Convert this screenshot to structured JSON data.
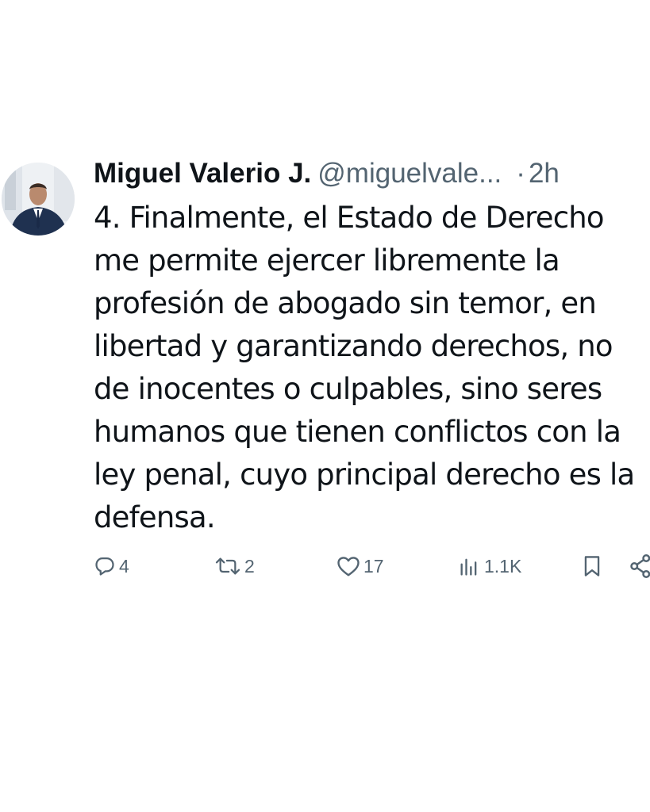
{
  "author": {
    "name": "Miguel Valerio J.",
    "handle": "@miguelvale...",
    "separator": "·",
    "time": "2h"
  },
  "tweet": {
    "text": "4. Finalmente, el Estado de Derecho\nme permite ejercer libremente la\nprofesión de abogado sin temor, en\nlibertad y garantizando derechos, no\nde inocentes o culpables, sino seres\nhumanos que tienen conflictos con la\nley penal, cuyo principal derecho es la\ndefensa."
  },
  "actions": {
    "replies": "4",
    "retweets": "2",
    "likes": "17",
    "views": "1.1K"
  },
  "icons": {
    "reply": "reply-icon",
    "retweet": "retweet-icon",
    "like": "heart-icon",
    "views": "views-icon",
    "bookmark": "bookmark-icon",
    "share": "share-icon"
  },
  "colors": {
    "text": "#0f1419",
    "muted": "#536471",
    "background": "#ffffff"
  }
}
